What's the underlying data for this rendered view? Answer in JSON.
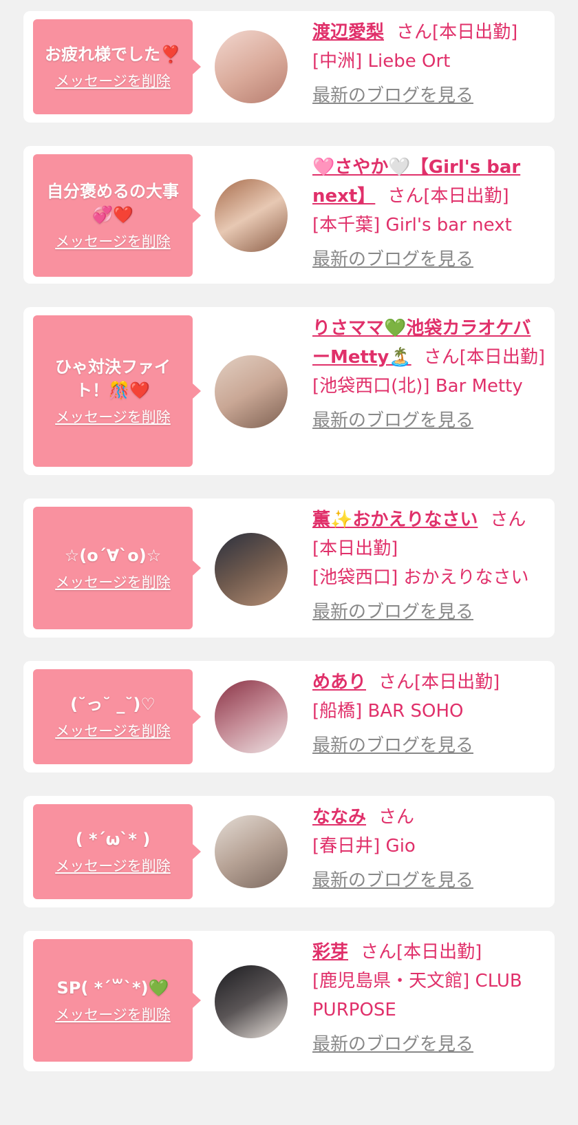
{
  "cards": [
    {
      "message": "お疲れ様でした❣️",
      "delete_label": "メッセージを削除",
      "name": "渡辺愛梨",
      "suffix": "さん[本日出勤]",
      "shop": "[中洲] Liebe Ort",
      "blog_label": "最新のブログを見る",
      "avatar_colors": [
        "#f2d7cf",
        "#c99a8e"
      ]
    },
    {
      "message": "自分褒めるの大事💞❤️",
      "delete_label": "メッセージを削除",
      "name": "🩷さやか🤍【Girl's bar next】",
      "suffix": "さん[本日出勤]",
      "shop": "[本千葉] Girl's bar next",
      "blog_label": "最新のブログを見る",
      "avatar_colors": [
        "#b07a5a",
        "#e9c9b6"
      ]
    },
    {
      "message": "ひゃ対決ファイト！🎊❤️",
      "delete_label": "メッセージを削除",
      "name": "りさママ💚池袋カラオケバーMetty🏝️",
      "suffix": "さん[本日出勤]",
      "shop": "[池袋西口(北)] Bar Metty",
      "blog_label": "最新のブログを見る",
      "avatar_colors": [
        "#d9c3b5",
        "#8d6e62"
      ]
    },
    {
      "message": "☆(o´∀`o)☆",
      "delete_label": "メッセージを削除",
      "name": "薫✨おかえりなさい",
      "suffix": "さん[本日出勤]",
      "shop": "[池袋西口] おかえりなさい",
      "blog_label": "最新のブログを見る",
      "avatar_colors": [
        "#2c3140",
        "#a2806a"
      ]
    },
    {
      "message": "(˘っ˘ _˘)♡",
      "delete_label": "メッセージを削除",
      "name": "めあり",
      "suffix": "さん[本日出勤]",
      "shop": "[船橋] BAR SOHO",
      "blog_label": "最新のブログを見る",
      "avatar_colors": [
        "#8a3346",
        "#e8d6d8"
      ]
    },
    {
      "message": "( *´ω`* )",
      "delete_label": "メッセージを削除",
      "name": "ななみ",
      "suffix": "さん",
      "shop": "[春日井] Gio",
      "blog_label": "最新のブログを見る",
      "avatar_colors": [
        "#d6cdc6",
        "#8d7b70"
      ]
    },
    {
      "message": "SP( *´꒳`*)💚",
      "delete_label": "メッセージを削除",
      "name": "彩芽",
      "suffix": "さん[本日出勤]",
      "shop": "[鹿児島県・天文館] CLUB PURPOSE",
      "blog_label": "最新のブログを見る",
      "avatar_colors": [
        "#1e1e22",
        "#e9e2dc"
      ]
    }
  ]
}
